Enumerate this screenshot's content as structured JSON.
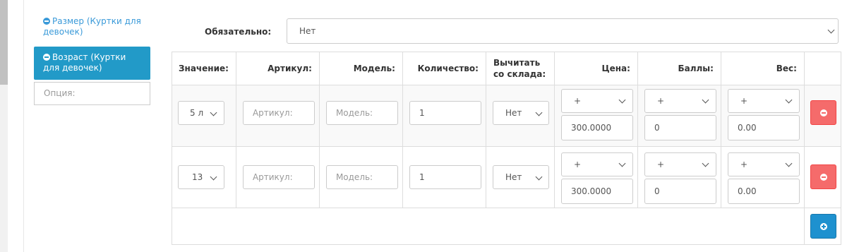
{
  "option_list": {
    "items": [
      {
        "label": "Размер (Куртки для девочек)",
        "active": false
      },
      {
        "label": "Возраст (Куртки для девочек)",
        "active": true
      }
    ],
    "new_option_placeholder": "Опция:"
  },
  "required": {
    "label": "Обязательно:",
    "value": "Нет"
  },
  "table": {
    "headers": {
      "value": "Значение:",
      "sku": "Артикул:",
      "model": "Модель:",
      "quantity": "Количество:",
      "subtract": "Вычитать со склада:",
      "price": "Цена:",
      "points": "Баллы:",
      "weight": "Вес:"
    },
    "rows": [
      {
        "value": "5 л",
        "sku_placeholder": "Артикул:",
        "model_placeholder": "Модель:",
        "quantity": "1",
        "subtract": "Нет",
        "price_prefix": "+",
        "price": "300.0000",
        "points_prefix": "+",
        "points": "0",
        "weight_prefix": "+",
        "weight": "0.00"
      },
      {
        "value": "13",
        "sku_placeholder": "Артикул:",
        "model_placeholder": "Модель:",
        "quantity": "1",
        "subtract": "Нет",
        "price_prefix": "+",
        "price": "300.0000",
        "points_prefix": "+",
        "points": "0",
        "weight_prefix": "+",
        "weight": "0.00"
      }
    ]
  },
  "colors": {
    "accent": "#229ac8",
    "danger": "#f56b6b",
    "primary": "#1e91cf"
  },
  "icons": {
    "remove": "minus-circle-icon",
    "add": "plus-circle-icon",
    "dropdown": "chevron-down-icon"
  }
}
